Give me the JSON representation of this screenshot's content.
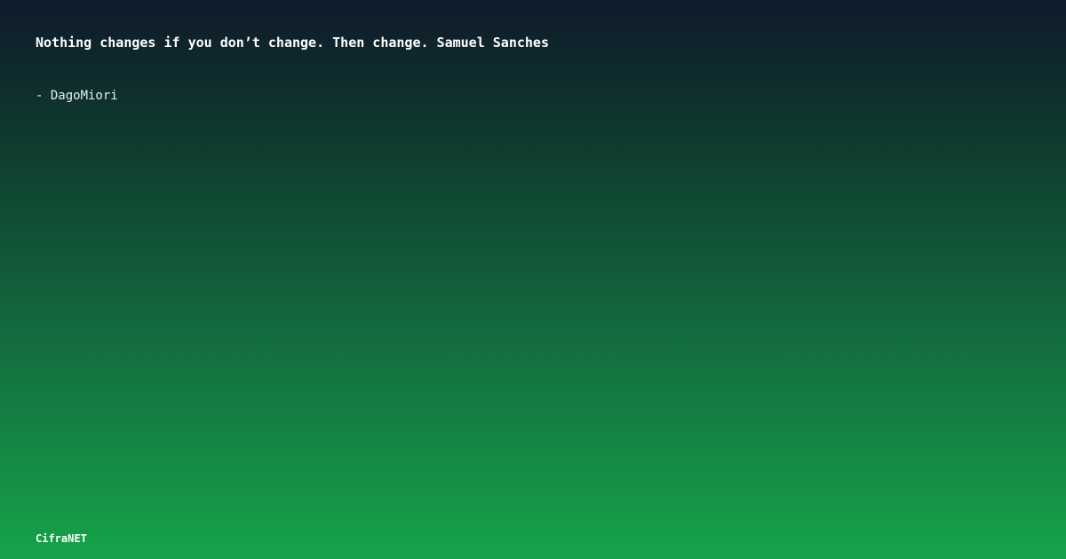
{
  "quote": {
    "text": "Nothing changes if you don’t change. Then change. Samuel Sanches",
    "author": "- DagoMiori"
  },
  "footer": {
    "brand": "CifraNET"
  },
  "colors": {
    "gradient_top": "#0f1a2c",
    "gradient_bottom": "#16a34a",
    "text": "#ffffff"
  }
}
